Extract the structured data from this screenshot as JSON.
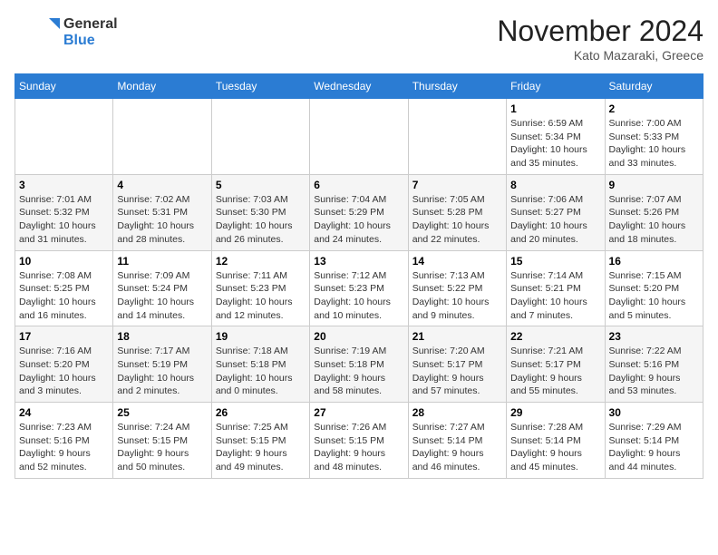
{
  "header": {
    "logo": {
      "line1": "General",
      "line2": "Blue"
    },
    "title": "November 2024",
    "location": "Kato Mazaraki, Greece"
  },
  "weekdays": [
    "Sunday",
    "Monday",
    "Tuesday",
    "Wednesday",
    "Thursday",
    "Friday",
    "Saturday"
  ],
  "weeks": [
    [
      {
        "day": "",
        "info": ""
      },
      {
        "day": "",
        "info": ""
      },
      {
        "day": "",
        "info": ""
      },
      {
        "day": "",
        "info": ""
      },
      {
        "day": "",
        "info": ""
      },
      {
        "day": "1",
        "info": "Sunrise: 6:59 AM\nSunset: 5:34 PM\nDaylight: 10 hours\nand 35 minutes."
      },
      {
        "day": "2",
        "info": "Sunrise: 7:00 AM\nSunset: 5:33 PM\nDaylight: 10 hours\nand 33 minutes."
      }
    ],
    [
      {
        "day": "3",
        "info": "Sunrise: 7:01 AM\nSunset: 5:32 PM\nDaylight: 10 hours\nand 31 minutes."
      },
      {
        "day": "4",
        "info": "Sunrise: 7:02 AM\nSunset: 5:31 PM\nDaylight: 10 hours\nand 28 minutes."
      },
      {
        "day": "5",
        "info": "Sunrise: 7:03 AM\nSunset: 5:30 PM\nDaylight: 10 hours\nand 26 minutes."
      },
      {
        "day": "6",
        "info": "Sunrise: 7:04 AM\nSunset: 5:29 PM\nDaylight: 10 hours\nand 24 minutes."
      },
      {
        "day": "7",
        "info": "Sunrise: 7:05 AM\nSunset: 5:28 PM\nDaylight: 10 hours\nand 22 minutes."
      },
      {
        "day": "8",
        "info": "Sunrise: 7:06 AM\nSunset: 5:27 PM\nDaylight: 10 hours\nand 20 minutes."
      },
      {
        "day": "9",
        "info": "Sunrise: 7:07 AM\nSunset: 5:26 PM\nDaylight: 10 hours\nand 18 minutes."
      }
    ],
    [
      {
        "day": "10",
        "info": "Sunrise: 7:08 AM\nSunset: 5:25 PM\nDaylight: 10 hours\nand 16 minutes."
      },
      {
        "day": "11",
        "info": "Sunrise: 7:09 AM\nSunset: 5:24 PM\nDaylight: 10 hours\nand 14 minutes."
      },
      {
        "day": "12",
        "info": "Sunrise: 7:11 AM\nSunset: 5:23 PM\nDaylight: 10 hours\nand 12 minutes."
      },
      {
        "day": "13",
        "info": "Sunrise: 7:12 AM\nSunset: 5:23 PM\nDaylight: 10 hours\nand 10 minutes."
      },
      {
        "day": "14",
        "info": "Sunrise: 7:13 AM\nSunset: 5:22 PM\nDaylight: 10 hours\nand 9 minutes."
      },
      {
        "day": "15",
        "info": "Sunrise: 7:14 AM\nSunset: 5:21 PM\nDaylight: 10 hours\nand 7 minutes."
      },
      {
        "day": "16",
        "info": "Sunrise: 7:15 AM\nSunset: 5:20 PM\nDaylight: 10 hours\nand 5 minutes."
      }
    ],
    [
      {
        "day": "17",
        "info": "Sunrise: 7:16 AM\nSunset: 5:20 PM\nDaylight: 10 hours\nand 3 minutes."
      },
      {
        "day": "18",
        "info": "Sunrise: 7:17 AM\nSunset: 5:19 PM\nDaylight: 10 hours\nand 2 minutes."
      },
      {
        "day": "19",
        "info": "Sunrise: 7:18 AM\nSunset: 5:18 PM\nDaylight: 10 hours\nand 0 minutes."
      },
      {
        "day": "20",
        "info": "Sunrise: 7:19 AM\nSunset: 5:18 PM\nDaylight: 9 hours\nand 58 minutes."
      },
      {
        "day": "21",
        "info": "Sunrise: 7:20 AM\nSunset: 5:17 PM\nDaylight: 9 hours\nand 57 minutes."
      },
      {
        "day": "22",
        "info": "Sunrise: 7:21 AM\nSunset: 5:17 PM\nDaylight: 9 hours\nand 55 minutes."
      },
      {
        "day": "23",
        "info": "Sunrise: 7:22 AM\nSunset: 5:16 PM\nDaylight: 9 hours\nand 53 minutes."
      }
    ],
    [
      {
        "day": "24",
        "info": "Sunrise: 7:23 AM\nSunset: 5:16 PM\nDaylight: 9 hours\nand 52 minutes."
      },
      {
        "day": "25",
        "info": "Sunrise: 7:24 AM\nSunset: 5:15 PM\nDaylight: 9 hours\nand 50 minutes."
      },
      {
        "day": "26",
        "info": "Sunrise: 7:25 AM\nSunset: 5:15 PM\nDaylight: 9 hours\nand 49 minutes."
      },
      {
        "day": "27",
        "info": "Sunrise: 7:26 AM\nSunset: 5:15 PM\nDaylight: 9 hours\nand 48 minutes."
      },
      {
        "day": "28",
        "info": "Sunrise: 7:27 AM\nSunset: 5:14 PM\nDaylight: 9 hours\nand 46 minutes."
      },
      {
        "day": "29",
        "info": "Sunrise: 7:28 AM\nSunset: 5:14 PM\nDaylight: 9 hours\nand 45 minutes."
      },
      {
        "day": "30",
        "info": "Sunrise: 7:29 AM\nSunset: 5:14 PM\nDaylight: 9 hours\nand 44 minutes."
      }
    ]
  ]
}
